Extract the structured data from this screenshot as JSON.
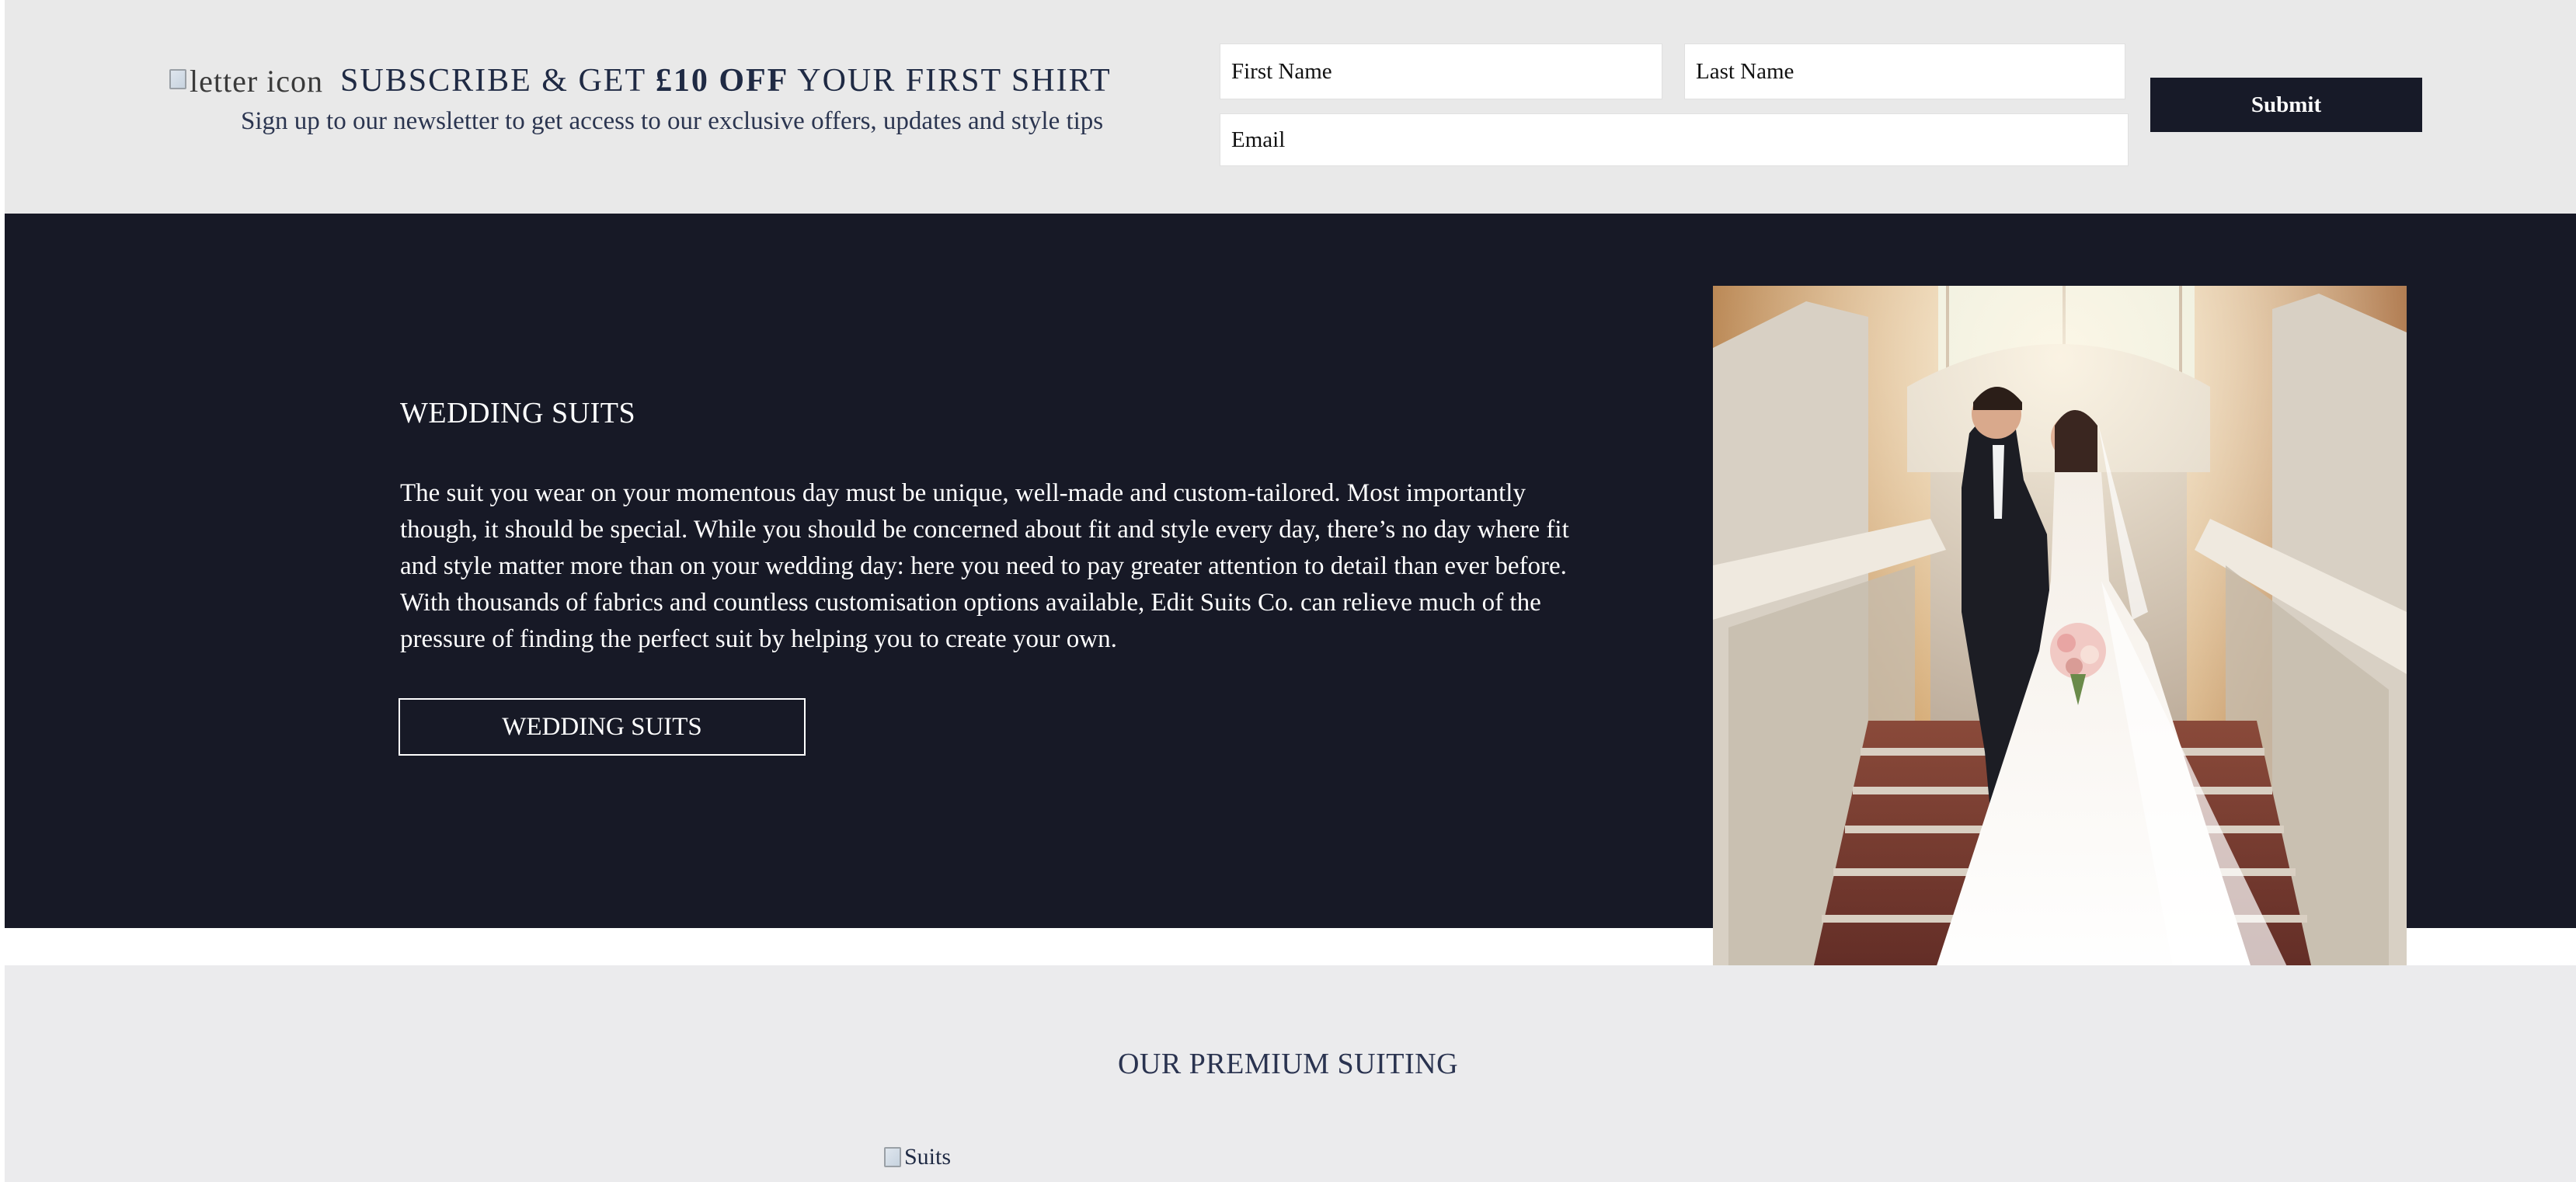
{
  "newsletter": {
    "icon_alt": "letter icon",
    "headline_part1": "SUBSCRIBE & GET ",
    "headline_bold": "£10 OFF",
    "headline_part2": " YOUR FIRST SHIRT",
    "subtext": "Sign up to our newsletter to get access to our exclusive offers, updates and style tips",
    "first_name_placeholder": "First Name",
    "last_name_placeholder": "Last Name",
    "email_placeholder": "Email",
    "submit_label": "Submit"
  },
  "wedding": {
    "title": "WEDDING SUITS",
    "body": "The suit you wear on your momentous day must be unique, well-made and custom-tailored. Most importantly though, it should be special. While you should be concerned about fit and style every day, there’s no day where fit and style matter more than on your wedding day: here you need to pay greater attention to detail than ever before. With thousands of fabrics and countless customisation options available, Edit Suits Co. can relieve much of the pressure of finding the perfect suit by helping you to create your own.",
    "button_label": "WEDDING SUITS"
  },
  "premium": {
    "title": "OUR PREMIUM SUITING",
    "image_alt": "Suits"
  },
  "colors": {
    "navy": "#171926",
    "band_grey": "#e9e9e9",
    "text_navy": "#1f2a44"
  }
}
